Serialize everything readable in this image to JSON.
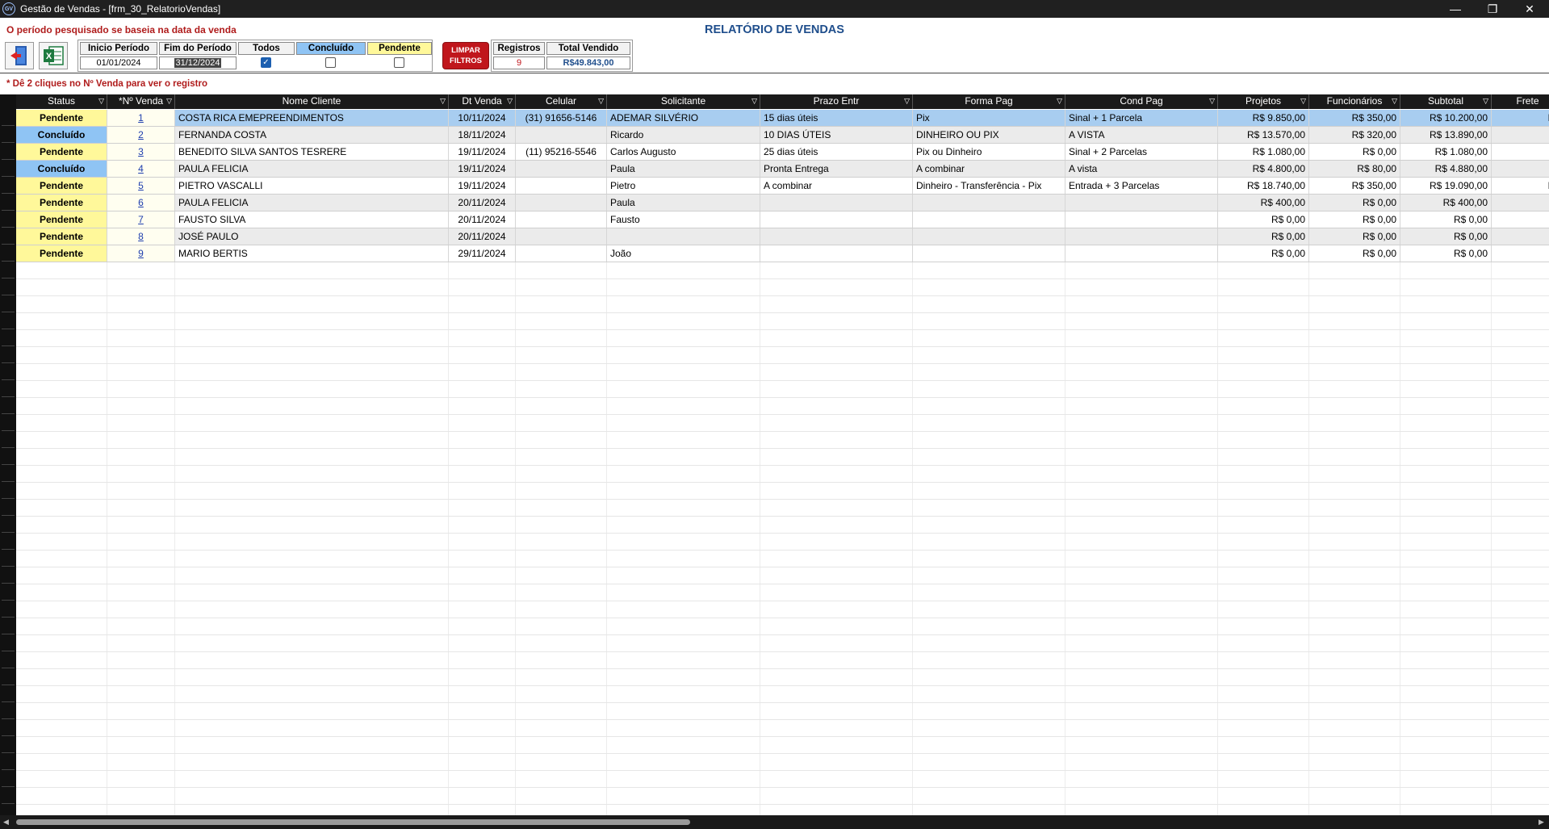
{
  "window": {
    "title": "Gestão de Vendas - [frm_30_RelatorioVendas]",
    "icon": "app-logo-icon",
    "minimize": "—",
    "maximize": "❐",
    "close": "✕"
  },
  "header": {
    "filter_note": "O período pesquisado se baseia na data da venda",
    "report_title": "RELATÓRIO DE VENDAS",
    "hint": "* Dê 2 cliques no Nº Venda para ver o registro"
  },
  "toolbar": {
    "exit_icon": "exit-door-icon",
    "excel_icon": "excel-icon"
  },
  "filters": {
    "start_label": "Inicio Período",
    "start_value": "01/01/2024",
    "end_label": "Fim do Período",
    "end_value": "31/12/2024",
    "all_label": "Todos",
    "all_checked": true,
    "done_label": "Concluído",
    "done_checked": false,
    "pending_label": "Pendente",
    "pending_checked": false,
    "clear_label_1": "LIMPAR",
    "clear_label_2": "FILTROS"
  },
  "stats": {
    "records_label": "Registros",
    "records_value": "9",
    "total_label": "Total Vendido",
    "total_value": "R$49.843,00"
  },
  "colors": {
    "pending": "#fff89a",
    "done": "#8fc4f4",
    "selected_row": "#a8cdf0",
    "alt_row": "#ebebeb"
  },
  "columns": [
    "Status",
    "*Nº Venda",
    "Nome Cliente",
    "Dt Venda",
    "Celular",
    "Solicitante",
    "Prazo Entr",
    "Forma Pag",
    "Cond Pag",
    "Projetos",
    "Funcionários",
    "Subtotal",
    "Frete"
  ],
  "rows": [
    {
      "status": "Pendente",
      "num": "1",
      "cliente": "COSTA RICA EMEPREENDIMENTOS",
      "dt": "10/11/2024",
      "cel": "(31) 91656-5146",
      "sol": "ADEMAR SILVÉRIO",
      "prazo": "15 dias úteis",
      "forma": "Pix",
      "cond": "Sinal + 1 Parcela",
      "proj": "R$ 9.850,00",
      "func": "R$ 350,00",
      "sub": "R$ 10.200,00",
      "frete": "R$"
    },
    {
      "status": "Concluído",
      "num": "2",
      "cliente": "FERNANDA COSTA",
      "dt": "18/11/2024",
      "cel": "",
      "sol": "Ricardo",
      "prazo": "10 DIAS ÚTEIS",
      "forma": "DINHEIRO OU PIX",
      "cond": "A VISTA",
      "proj": "R$ 13.570,00",
      "func": "R$ 320,00",
      "sub": "R$ 13.890,00",
      "frete": "R"
    },
    {
      "status": "Pendente",
      "num": "3",
      "cliente": "BENEDITO SILVA SANTOS TESRERE",
      "dt": "19/11/2024",
      "cel": "(11) 95216-5546",
      "sol": "Carlos Augusto",
      "prazo": "25 dias úteis",
      "forma": "Pix ou Dinheiro",
      "cond": "Sinal + 2 Parcelas",
      "proj": "R$ 1.080,00",
      "func": "R$ 0,00",
      "sub": "R$ 1.080,00",
      "frete": "I"
    },
    {
      "status": "Concluído",
      "num": "4",
      "cliente": "PAULA FELICIA",
      "dt": "19/11/2024",
      "cel": "",
      "sol": "Paula",
      "prazo": "Pronta Entrega",
      "forma": "A combinar",
      "cond": "A vista",
      "proj": "R$ 4.800,00",
      "func": "R$ 80,00",
      "sub": "R$ 4.880,00",
      "frete": "R"
    },
    {
      "status": "Pendente",
      "num": "5",
      "cliente": "PIETRO VASCALLI",
      "dt": "19/11/2024",
      "cel": "",
      "sol": "Pietro",
      "prazo": "A combinar",
      "forma": "Dinheiro - Transferência - Pix",
      "cond": "Entrada + 3 Parcelas",
      "proj": "R$ 18.740,00",
      "func": "R$ 350,00",
      "sub": "R$ 19.090,00",
      "frete": "R$"
    },
    {
      "status": "Pendente",
      "num": "6",
      "cliente": "PAULA FELICIA",
      "dt": "20/11/2024",
      "cel": "",
      "sol": "Paula",
      "prazo": "",
      "forma": "",
      "cond": "",
      "proj": "R$ 400,00",
      "func": "R$ 0,00",
      "sub": "R$ 400,00",
      "frete": "I"
    },
    {
      "status": "Pendente",
      "num": "7",
      "cliente": "FAUSTO SILVA",
      "dt": "20/11/2024",
      "cel": "",
      "sol": "Fausto",
      "prazo": "",
      "forma": "",
      "cond": "",
      "proj": "R$ 0,00",
      "func": "R$ 0,00",
      "sub": "R$ 0,00",
      "frete": "I"
    },
    {
      "status": "Pendente",
      "num": "8",
      "cliente": "JOSÉ PAULO",
      "dt": "20/11/2024",
      "cel": "",
      "sol": "",
      "prazo": "",
      "forma": "",
      "cond": "",
      "proj": "R$ 0,00",
      "func": "R$ 0,00",
      "sub": "R$ 0,00",
      "frete": "I"
    },
    {
      "status": "Pendente",
      "num": "9",
      "cliente": "MARIO BERTIS",
      "dt": "29/11/2024",
      "cel": "",
      "sol": "João",
      "prazo": "",
      "forma": "",
      "cond": "",
      "proj": "R$ 0,00",
      "func": "R$ 0,00",
      "sub": "R$ 0,00",
      "frete": "I"
    }
  ]
}
